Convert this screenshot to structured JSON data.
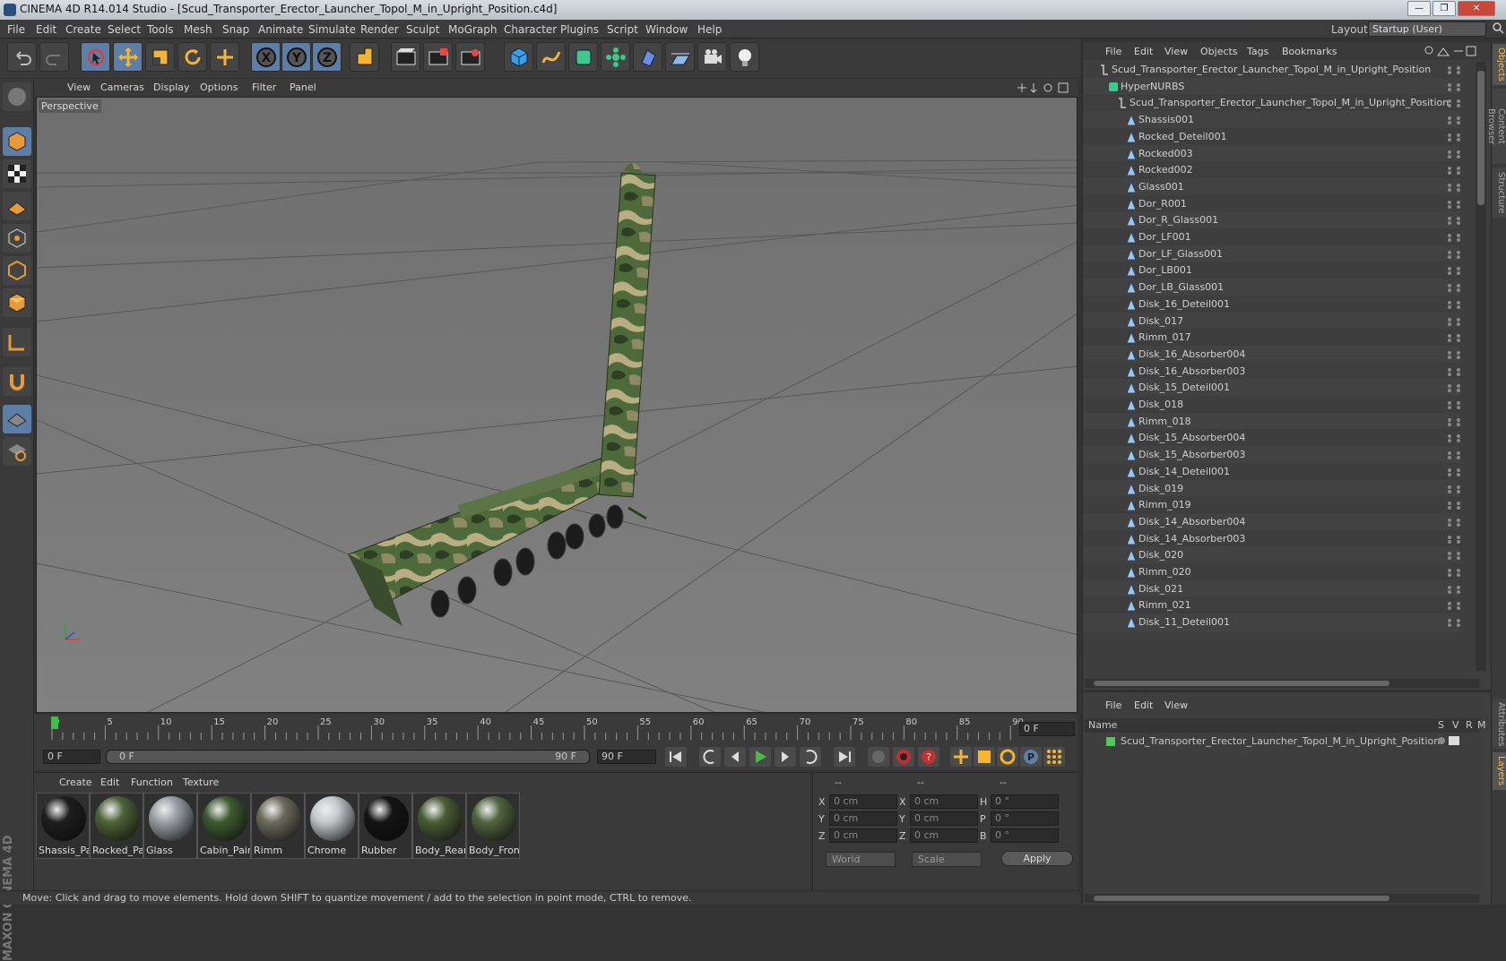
{
  "window": {
    "title": "CINEMA 4D R14.014 Studio - [Scud_Transporter_Erector_Launcher_Topol_M_in_Upright_Position.c4d]",
    "minimize": "—",
    "restore": "❐",
    "close": "✕"
  },
  "menubar": {
    "items": [
      "File",
      "Edit",
      "Create",
      "Select",
      "Tools",
      "Mesh",
      "Snap",
      "Animate",
      "Simulate",
      "Render",
      "Sculpt",
      "MoGraph",
      "Character",
      "Plugins",
      "Script",
      "Window",
      "Help"
    ],
    "layout_label": "Layout:",
    "layout_value": "Startup (User)"
  },
  "toolbar": {
    "icons": [
      "undo-icon",
      "redo-icon",
      "live-select-icon",
      "move-icon",
      "scale-icon",
      "rotate-icon",
      "select-all-icon",
      "x-axis-icon",
      "y-axis-icon",
      "z-axis-icon",
      "coordinate-system-icon",
      "render-view-icon",
      "render-picture-viewer-icon",
      "edit-render-settings-icon",
      "cube-icon",
      "spline-icon",
      "nurbs-icon",
      "array-icon",
      "deformer-icon",
      "floor-icon",
      "camera-icon",
      "light-icon"
    ]
  },
  "left_tools": {
    "icons": [
      "sphere-mode-icon",
      "model-mode-icon",
      "texture-mode-icon",
      "workplane-icon",
      "points-mode-icon",
      "edges-mode-icon",
      "polygons-mode-icon",
      "axis-icon",
      "magnet-icon",
      "grid-snap-icon",
      "locked-workplane-icon"
    ],
    "brand": "MAXON CINEMA 4D"
  },
  "viewport": {
    "menu": [
      "View",
      "Cameras",
      "Display",
      "Options",
      "Filter",
      "Panel"
    ],
    "label": "Perspective"
  },
  "timeline": {
    "ticks": [
      "0",
      "5",
      "10",
      "15",
      "20",
      "25",
      "30",
      "35",
      "40",
      "45",
      "50",
      "55",
      "60",
      "65",
      "70",
      "75",
      "80",
      "85",
      "90"
    ],
    "current_frame": "0 F"
  },
  "transport": {
    "start": "0 F",
    "range_start": "0 F",
    "range_end": "90 F",
    "end": "90 F"
  },
  "materials": {
    "menu": [
      "Create",
      "Edit",
      "Function",
      "Texture"
    ],
    "items": [
      {
        "name": "Shassis_Pai",
        "color": "#1e1e1e"
      },
      {
        "name": "Rocked_Pa",
        "color": "#4e6238"
      },
      {
        "name": "Glass",
        "color": "#9aa0a6"
      },
      {
        "name": "Cabin_Pain",
        "color": "#3f5a30"
      },
      {
        "name": "Rimm",
        "color": "#6d6a5e"
      },
      {
        "name": "Chrome",
        "color": "#c4c8cc"
      },
      {
        "name": "Rubber",
        "color": "#141414"
      },
      {
        "name": "Body_Rear",
        "color": "#4a5c36"
      },
      {
        "name": "Body_Fron",
        "color": "#506540"
      }
    ]
  },
  "coordinates": {
    "headers": [
      "--",
      "--",
      "--"
    ],
    "rows": [
      {
        "a": "X",
        "av": "0 cm",
        "b": "X",
        "bv": "0 cm",
        "c": "H",
        "cv": "0 °"
      },
      {
        "a": "Y",
        "av": "0 cm",
        "b": "Y",
        "bv": "0 cm",
        "c": "P",
        "cv": "0 °"
      },
      {
        "a": "Z",
        "av": "0 cm",
        "b": "Z",
        "bv": "0 cm",
        "c": "B",
        "cv": "0 °"
      }
    ],
    "world": "World",
    "scale": "Scale",
    "apply": "Apply"
  },
  "status": "Move: Click and drag to move elements. Hold down SHIFT to quantize movement / add to the selection in point mode, CTRL to remove.",
  "objects": {
    "menu": [
      "File",
      "Edit",
      "View",
      "Objects",
      "Tags",
      "Bookmarks"
    ],
    "root": "Scud_Transporter_Erector_Launcher_Topol_M_in_Upright_Position",
    "hypernurbs": "HyperNURBS",
    "group": "Scud_Transporter_Erector_Launcher_Topol_M_in_Upright_Position",
    "items": [
      "Shassis001",
      "Rocked_Deteil001",
      "Rocked003",
      "Rocked002",
      "Glass001",
      "Dor_R001",
      "Dor_R_Glass001",
      "Dor_LF001",
      "Dor_LF_Glass001",
      "Dor_LB001",
      "Dor_LB_Glass001",
      "Disk_16_Deteil001",
      "Disk_017",
      "Rimm_017",
      "Disk_16_Absorber004",
      "Disk_16_Absorber003",
      "Disk_15_Deteil001",
      "Disk_018",
      "Rimm_018",
      "Disk_15_Absorber004",
      "Disk_15_Absorber003",
      "Disk_14_Deteil001",
      "Disk_019",
      "Rimm_019",
      "Disk_14_Absorber004",
      "Disk_14_Absorber003",
      "Disk_020",
      "Rimm_020",
      "Disk_021",
      "Rimm_021",
      "Disk_11_Deteil001"
    ]
  },
  "layers": {
    "menu": [
      "File",
      "Edit",
      "View"
    ],
    "col_name": "Name",
    "cols": [
      "S",
      "V",
      "R",
      "M"
    ],
    "row": "Scud_Transporter_Erector_Launcher_Topol_M_in_Upright_Position"
  },
  "side_tabs": [
    "Objects",
    "Content Browser",
    "Structure",
    "Attributes",
    "Layers"
  ]
}
